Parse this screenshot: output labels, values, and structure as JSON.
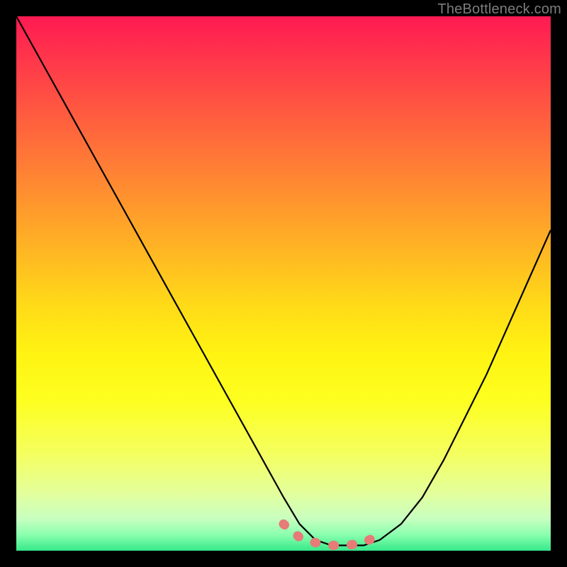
{
  "credit_text": "TheBottleneck.com",
  "chart_data": {
    "type": "line",
    "title": "",
    "xlabel": "",
    "ylabel": "",
    "xlim": [
      0,
      100
    ],
    "ylim": [
      0,
      100
    ],
    "series": [
      {
        "name": "bottleneck-curve",
        "x": [
          0,
          5,
          10,
          15,
          20,
          25,
          30,
          35,
          40,
          45,
          50,
          53,
          56,
          59,
          62,
          65,
          68,
          72,
          76,
          80,
          84,
          88,
          92,
          96,
          100
        ],
        "y": [
          100,
          91,
          82,
          73,
          64,
          55,
          46,
          37,
          28,
          19,
          10,
          5,
          2,
          1,
          1,
          1,
          2,
          5,
          10,
          17,
          25,
          33,
          42,
          51,
          60
        ]
      }
    ],
    "trough_segment": {
      "name": "optimal-range-marker",
      "color": "#e77b77",
      "x": [
        50,
        53,
        56,
        59,
        62,
        65,
        68
      ],
      "y": [
        5,
        2.5,
        1.5,
        1,
        1,
        1.5,
        3
      ]
    },
    "background_gradient": {
      "stops": [
        {
          "pos": 0.0,
          "color": "#ff1a52"
        },
        {
          "pos": 0.5,
          "color": "#ffda18"
        },
        {
          "pos": 0.82,
          "color": "#f4ff60"
        },
        {
          "pos": 1.0,
          "color": "#36e98a"
        }
      ]
    }
  }
}
